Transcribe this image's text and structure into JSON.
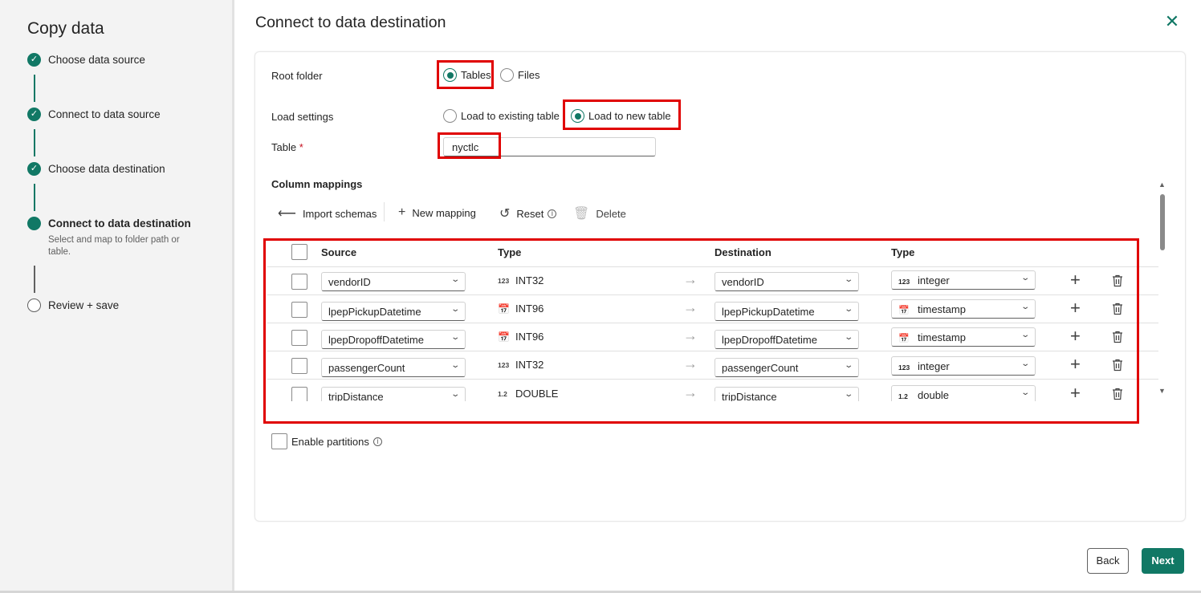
{
  "sidebar": {
    "title": "Copy data",
    "steps": [
      {
        "label": "Choose data source",
        "status": "done"
      },
      {
        "label": "Connect to data source",
        "status": "done"
      },
      {
        "label": "Choose data destination",
        "status": "done"
      },
      {
        "label": "Connect to data destination",
        "status": "active",
        "description": "Select and map to folder path or table."
      },
      {
        "label": "Review + save",
        "status": "pending"
      }
    ]
  },
  "main": {
    "title": "Connect to data destination",
    "root_folder": {
      "label": "Root folder",
      "options": [
        "Tables",
        "Files"
      ],
      "selected": "Tables"
    },
    "load_settings": {
      "label": "Load settings",
      "options": [
        "Load to existing table",
        "Load to new table"
      ],
      "selected": "Load to new table"
    },
    "table": {
      "label": "Table",
      "required_mark": "*",
      "value": "nyctlc"
    },
    "column_mappings": {
      "title": "Column mappings",
      "toolbar": {
        "import_schemas": "Import schemas",
        "new_mapping": "New mapping",
        "reset": "Reset",
        "delete": "Delete"
      },
      "headers": {
        "source": "Source",
        "source_type": "Type",
        "destination": "Destination",
        "destination_type": "Type"
      },
      "rows": [
        {
          "source": "vendorID",
          "source_type": "INT32",
          "source_type_icon": "123",
          "destination": "vendorID",
          "dest_type": "integer",
          "dest_type_icon": "123"
        },
        {
          "source": "lpepPickupDatetime",
          "source_type": "INT96",
          "source_type_icon": "calendar-icon",
          "destination": "lpepPickupDatetime",
          "dest_type": "timestamp",
          "dest_type_icon": "calendar-icon"
        },
        {
          "source": "lpepDropoffDatetime",
          "source_type": "INT96",
          "source_type_icon": "calendar-icon",
          "destination": "lpepDropoffDatetime",
          "dest_type": "timestamp",
          "dest_type_icon": "calendar-icon"
        },
        {
          "source": "passengerCount",
          "source_type": "INT32",
          "source_type_icon": "123",
          "destination": "passengerCount",
          "dest_type": "integer",
          "dest_type_icon": "123"
        },
        {
          "source": "tripDistance",
          "source_type": "DOUBLE",
          "source_type_icon": "1.2",
          "destination": "tripDistance",
          "dest_type": "double",
          "dest_type_icon": "1.2"
        }
      ]
    },
    "enable_partitions": {
      "label": "Enable partitions",
      "checked": false
    }
  },
  "footer": {
    "back": "Back",
    "next": "Next"
  },
  "colors": {
    "accent": "#117865",
    "highlight": "#e00000"
  }
}
